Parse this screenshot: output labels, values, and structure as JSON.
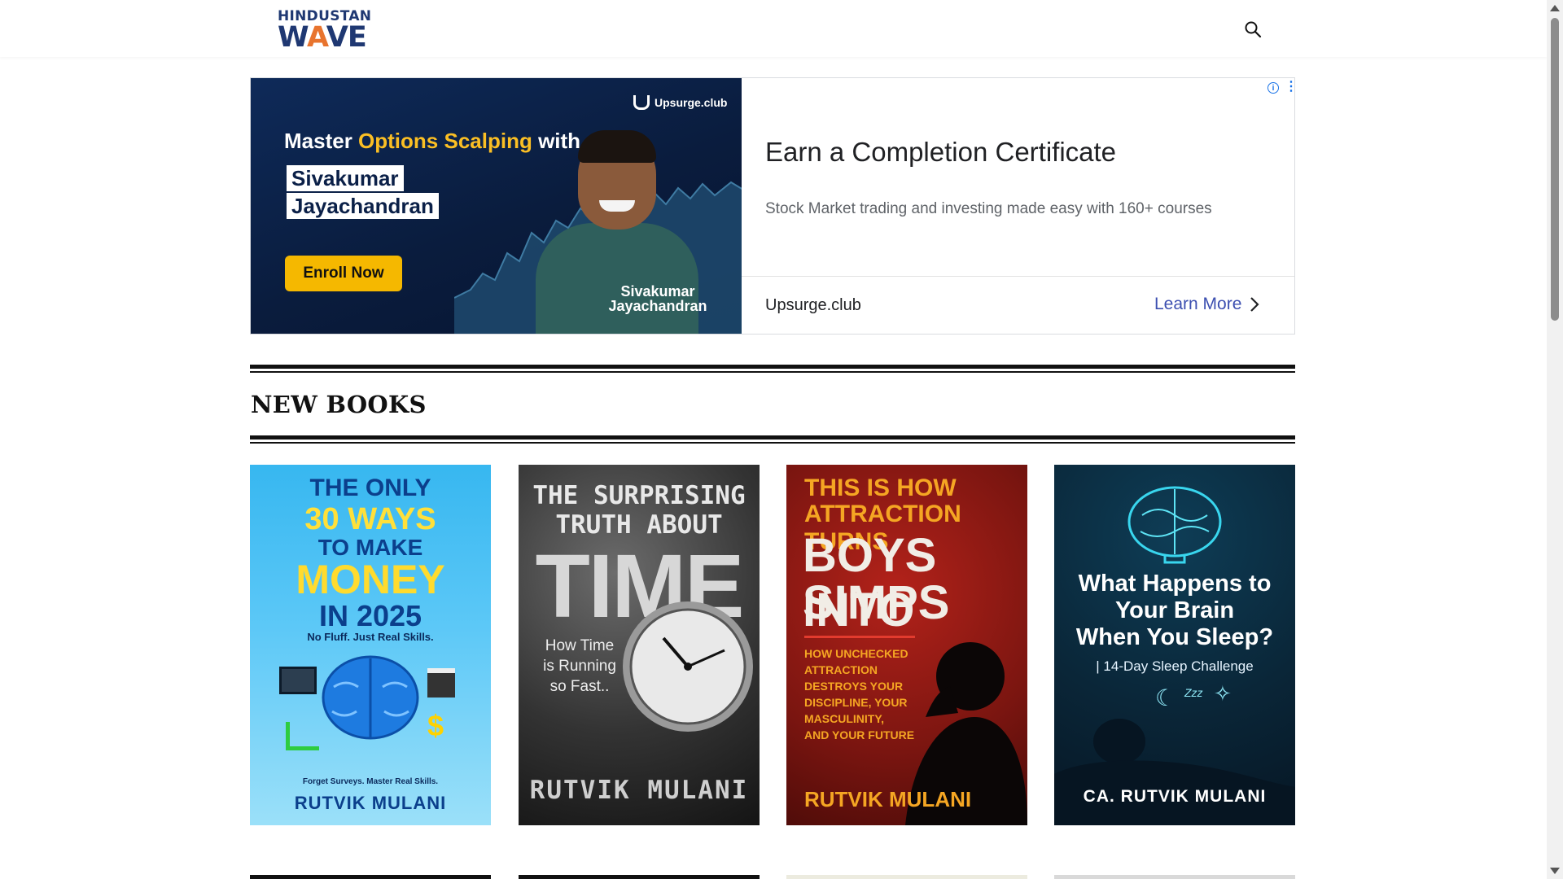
{
  "header": {
    "logo_line1": "HINDUSTAN",
    "logo_line2_a": "W",
    "logo_line2_b": "A",
    "logo_line2_c": "VE",
    "search_icon": "search-icon"
  },
  "ad": {
    "brand": "Upsurge.club",
    "headline_prefix": "Master ",
    "headline_highlight": "Options Scalping",
    "headline_suffix": " with",
    "name_line1": "Sivakumar",
    "name_line2": "Jayachandran",
    "cta_visual": "Enroll Now",
    "caption_line1": "Sivakumar",
    "caption_line2": "Jayachandran",
    "title": "Earn a Completion Certificate",
    "description": "Stock Market trading and investing made easy with 160+ courses",
    "domain": "Upsurge.club",
    "learn_more": "Learn More",
    "info_glyph": "i",
    "menu_glyph": "⋮"
  },
  "section": {
    "title": "NEW BOOKS"
  },
  "books": [
    {
      "lines": [
        "THE ONLY",
        "30 WAYS",
        "TO MAKE",
        "MONEY",
        "IN 2025"
      ],
      "tagline": "No Fluff. Just Real Skills.",
      "footer_tag": "Forget Surveys. Master Real Skills.",
      "author": "RUTVIK MULANI"
    },
    {
      "lines": [
        "THE SURPRISING",
        "TRUTH ABOUT",
        "TIME"
      ],
      "subtitle": [
        "How Time",
        "is Running",
        "so Fast.."
      ],
      "author": "RUTVIK MULANI"
    },
    {
      "lines": [
        "THIS IS HOW",
        "ATTRACTION TURNS",
        "BOYS INTO",
        "SIMPS"
      ],
      "subtitle": [
        "HOW UNCHECKED",
        "ATTRACTION",
        "DESTROYS YOUR",
        "DISCIPLINE, YOUR",
        "MASCULINITY,",
        "AND YOUR FUTURE"
      ],
      "author": "RUTVIK MULANI"
    },
    {
      "lines": [
        "What Happens to",
        "Your Brain",
        "When You Sleep?"
      ],
      "subtitle": "| 14-Day Sleep Challenge",
      "author": "CA. RUTVIK MULANI"
    }
  ],
  "colors": {
    "brand_navy": "#1f3872",
    "brand_orange": "#e8742e",
    "ad_link": "#3c4fb0",
    "ad_cta": "#f5b800"
  }
}
